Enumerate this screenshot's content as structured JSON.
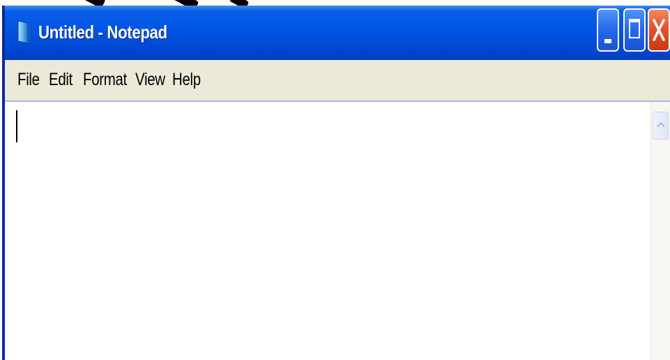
{
  "window": {
    "title": "Untitled - Notepad",
    "icon": "notepad-icon",
    "controls": {
      "minimize_icon": "minimize-icon",
      "maximize_icon": "maximize-icon",
      "close_icon": "close-icon"
    },
    "colors": {
      "titlebar": "#0054e3",
      "close_button": "#e2532b",
      "menubar": "#ece9d8"
    }
  },
  "menu": {
    "file": "File",
    "edit": "Edit",
    "format": "Format",
    "view": "View",
    "help": "Help"
  },
  "editor": {
    "text": ""
  },
  "scrollbar": {
    "up_icon": "chevron-up-icon"
  }
}
